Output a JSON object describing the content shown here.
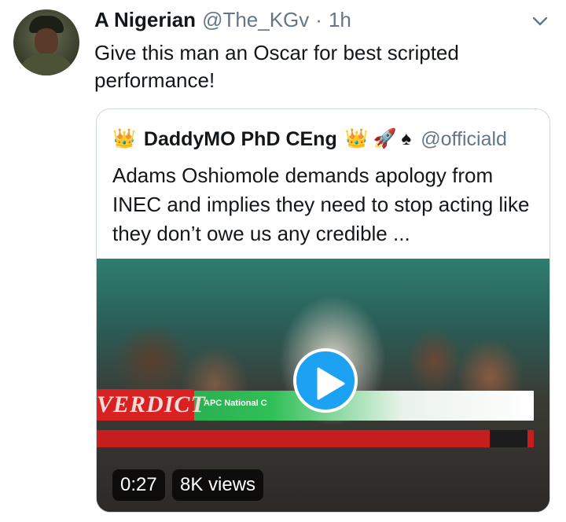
{
  "tweet": {
    "author_name": "A Nigerian",
    "author_handle": "@The_KGv",
    "separator": "·",
    "time": "1h",
    "text": "Give this man an Oscar for best scripted performance!"
  },
  "quoted_tweet": {
    "author_name": "DaddyMO PhD CEng",
    "author_handle": "@officiald",
    "emoji_crown": "👑",
    "emoji_rocket": "🚀",
    "emoji_spade": "♠",
    "text": "Adams Oshiomole demands apology from INEC and implies they need to stop acting like they don’t owe us any credible ...",
    "video": {
      "duration": "0:27",
      "views": "8K views",
      "overlay_banner_text": "VERDICT",
      "overlay_channel_text": "APC National C"
    }
  },
  "colors": {
    "accent": "#1da1f2",
    "text": "#14171a",
    "muted": "#657786",
    "border": "#ccd6dd"
  },
  "icons": [
    "avatar",
    "caret-down-icon",
    "play-icon"
  ]
}
